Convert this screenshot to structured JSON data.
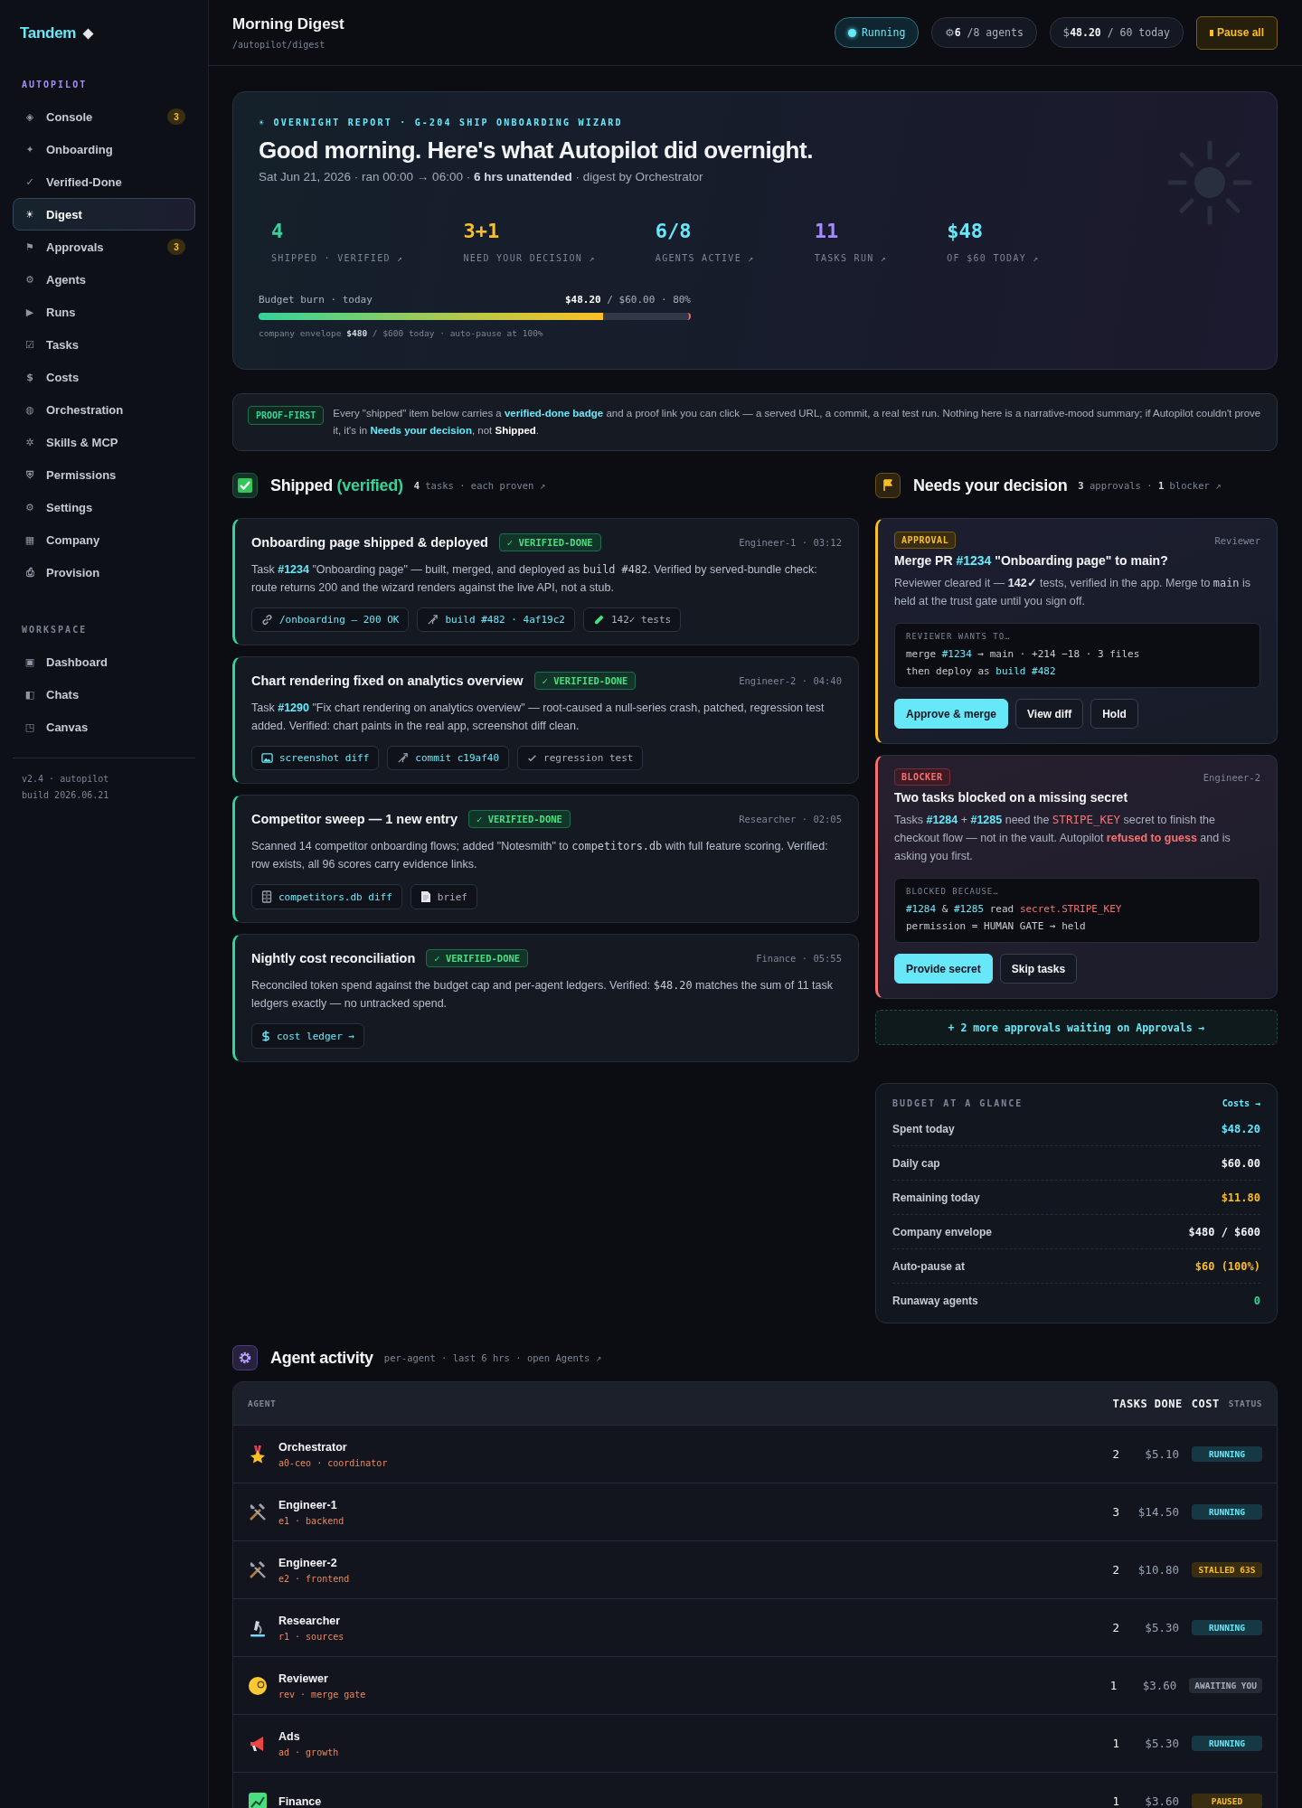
{
  "sidebar": {
    "logo": "Tandem",
    "sections": [
      {
        "title": "AUTOPILOT",
        "color": "#a78bfa",
        "items": [
          {
            "glyph": "◈",
            "label": "Console",
            "badge": "3",
            "selected": false
          },
          {
            "glyph": "✦",
            "label": "Onboarding",
            "selected": false
          },
          {
            "glyph": "✓",
            "label": "Verified-Done",
            "selected": false
          },
          {
            "glyph": "☀",
            "label": "Digest",
            "selected": true
          },
          {
            "glyph": "⚑",
            "label": "Approvals",
            "badge": "3",
            "selected": false
          },
          {
            "glyph": "⚙",
            "label": "Agents",
            "selected": false
          },
          {
            "glyph": "▶",
            "label": "Runs",
            "selected": false
          },
          {
            "glyph": "☑",
            "label": "Tasks",
            "selected": false
          },
          {
            "glyph": "$",
            "label": "Costs",
            "selected": false
          },
          {
            "glyph": "◍",
            "label": "Orchestration",
            "selected": false
          },
          {
            "glyph": "✲",
            "label": "Skills & MCP",
            "selected": false
          },
          {
            "glyph": "⛨",
            "label": "Permissions",
            "selected": false
          },
          {
            "glyph": "⚙",
            "label": "Settings",
            "selected": false
          },
          {
            "glyph": "▦",
            "label": "Company",
            "selected": false
          },
          {
            "glyph": "⎙",
            "label": "Provision",
            "selected": false
          }
        ]
      },
      {
        "title": "WORKSPACE",
        "color": "#7d8596",
        "items": [
          {
            "glyph": "▣",
            "label": "Dashboard",
            "selected": false
          },
          {
            "glyph": "◧",
            "label": "Chats",
            "selected": false
          },
          {
            "glyph": "◳",
            "label": "Canvas",
            "selected": false
          }
        ]
      }
    ],
    "footer": [
      "v2.4 · autopilot",
      "build 2026.06.21"
    ]
  },
  "header": {
    "title": "Morning Digest",
    "path": "/autopilot/digest",
    "status": "Running",
    "agents": {
      "glyph": "⚙",
      "value": "6",
      "rest": "/8 agents"
    },
    "budget": {
      "glyph": "$",
      "value": "48.20",
      "rest": "/ 60 today"
    },
    "pause_button": "Pause all"
  },
  "hero": {
    "kicker": "☀ OVERNIGHT REPORT · G-204 SHIP ONBOARDING WIZARD",
    "title": "Good morning. Here's what Autopilot did overnight.",
    "subtitle": "Sat Jun 21, 2026 · ran 00:00 → 06:00 · **6 hrs unattended** · digest by Orchestrator",
    "stats": [
      {
        "value": "4",
        "label": "SHIPPED · VERIFIED ↗",
        "color": "#34d399"
      },
      {
        "value": "3+1",
        "label": "NEED YOUR DECISION ↗",
        "color": "#fbbf24"
      },
      {
        "value": "6/8",
        "label": "AGENTS ACTIVE ↗",
        "color": "#67e8f9"
      },
      {
        "value": "11",
        "label": "TASKS RUN ↗",
        "color": "#a78bfa"
      },
      {
        "value": "$48",
        "label": "OF $60 TODAY ↗",
        "color": "#67e8f9"
      }
    ],
    "budget": {
      "label": "Budget burn · today",
      "reading": "**$48.20** / $60.00 · 80%",
      "level": 0.8,
      "note": "company envelope **$480** / $600 today · auto-pause at 100%"
    }
  },
  "notice": {
    "tag": "PROOF-FIRST",
    "text": [
      {
        "kind": "text",
        "text": "Every \"shipped\" item below carries a "
      },
      {
        "kind": "link",
        "text": "verified-done badge"
      },
      {
        "kind": "text",
        "text": " and a proof link you can click — a served URL, a commit, a real test run. Nothing here is a narrative-mood summary; if Autopilot couldn't prove it, it's in "
      },
      {
        "kind": "link",
        "text": "Needs your decision"
      },
      {
        "kind": "text",
        "text": ", not **Shipped**."
      }
    ]
  },
  "shipped": {
    "title": "Shipped",
    "accent": "(verified)",
    "meta": "**4** tasks · each proven ↗",
    "tasks": [
      {
        "title": "Onboarding page shipped & deployed",
        "badge": "✓ VERIFIED-DONE",
        "meta": "Engineer-1 · 03:12",
        "text": [
          {
            "kind": "text",
            "text": "Task "
          },
          {
            "kind": "ref",
            "text": "#1234"
          },
          {
            "kind": "text",
            "text": " \"Onboarding page\" — built, merged, and deployed as "
          },
          {
            "kind": "code",
            "text": "build #482"
          },
          {
            "kind": "text",
            "text": ". Verified by served-bundle check: route returns 200 and the wizard renders against the live API, not a stub."
          }
        ],
        "proofs": [
          {
            "kind": "link",
            "text": "/onboarding — 200 OK",
            "linked": true
          },
          {
            "kind": "branch",
            "text": "build #482 · 4af19c2",
            "linked": true
          },
          {
            "kind": "flask",
            "text": "142✓ tests",
            "linked": false
          }
        ]
      },
      {
        "title": "Chart rendering fixed on analytics overview",
        "badge": "✓ VERIFIED-DONE",
        "meta": "Engineer-2 · 04:40",
        "text": [
          {
            "kind": "text",
            "text": "Task "
          },
          {
            "kind": "ref",
            "text": "#1290"
          },
          {
            "kind": "text",
            "text": " \"Fix chart rendering on analytics overview\" — root-caused a null-series crash, patched, regression test added. Verified: chart paints in the real app, screenshot diff clean."
          }
        ],
        "proofs": [
          {
            "kind": "image",
            "text": "screenshot diff",
            "linked": true
          },
          {
            "kind": "branch",
            "text": "commit c19af40",
            "linked": true
          },
          {
            "kind": "check",
            "text": "regression test",
            "linked": false
          }
        ]
      },
      {
        "title": "Competitor sweep — 1 new entry",
        "badge": "✓ VERIFIED-DONE",
        "meta": "Researcher · 02:05",
        "text": [
          {
            "kind": "text",
            "text": "Scanned 14 competitor onboarding flows; added \"Notesmith\" to "
          },
          {
            "kind": "code",
            "text": "competitors.db"
          },
          {
            "kind": "text",
            "text": " with full feature scoring. Verified: row exists, all 96 scores carry evidence links."
          }
        ],
        "proofs": [
          {
            "kind": "db",
            "text": "competitors.db diff",
            "linked": true
          },
          {
            "kind": "doc",
            "text": "brief",
            "linked": false
          }
        ]
      },
      {
        "title": "Nightly cost reconciliation",
        "badge": "✓ VERIFIED-DONE",
        "meta": "Finance · 05:55",
        "text": [
          {
            "kind": "text",
            "text": "Reconciled token spend against the budget cap and per-agent ledgers. Verified: "
          },
          {
            "kind": "code",
            "text": "$48.20"
          },
          {
            "kind": "text",
            "text": " matches the sum of 11 task ledgers exactly — no untracked spend."
          }
        ],
        "proofs": [
          {
            "kind": "dollar",
            "text": "cost ledger →",
            "linked": true
          }
        ]
      }
    ]
  },
  "decisions": {
    "title": "Needs your decision",
    "meta": "**3** approvals · **1** blocker ↗",
    "cards": [
      {
        "kind": "approval",
        "tag": "APPROVAL",
        "who": "Reviewer",
        "title": [
          {
            "kind": "text",
            "text": "Merge PR "
          },
          {
            "kind": "ref",
            "text": "#1234"
          },
          {
            "kind": "text",
            "text": " \"Onboarding page\" to main?"
          }
        ],
        "text": [
          {
            "kind": "text",
            "text": "Reviewer cleared it — **142✓** tests, verified in the app. Merge to "
          },
          {
            "kind": "code",
            "text": "main"
          },
          {
            "kind": "text",
            "text": " is held at the trust gate until you sign off."
          }
        ],
        "box": {
          "label": "REVIEWER WANTS TO…",
          "lines": [
            [
              {
                "kind": "text",
                "text": "merge "
              },
              {
                "kind": "ref",
                "text": "#1234"
              },
              {
                "kind": "text",
                "text": " → main · +214 −18 · 3 files"
              }
            ],
            [
              {
                "kind": "text",
                "text": "then deploy as "
              },
              {
                "kind": "ref",
                "text": "build #482"
              }
            ]
          ]
        },
        "buttons": [
          {
            "label": "Approve & merge",
            "primary": true
          },
          {
            "label": "View diff",
            "primary": false
          },
          {
            "label": "Hold",
            "primary": false
          }
        ]
      },
      {
        "kind": "blocker",
        "tag": "BLOCKER",
        "who": "Engineer-2",
        "title": [
          {
            "kind": "text",
            "text": "Two tasks blocked on a missing secret"
          }
        ],
        "text": [
          {
            "kind": "text",
            "text": "Tasks "
          },
          {
            "kind": "ref",
            "text": "#1284"
          },
          {
            "kind": "text",
            "text": " + "
          },
          {
            "kind": "ref",
            "text": "#1285"
          },
          {
            "kind": "text",
            "text": " need the "
          },
          {
            "kind": "secret",
            "text": "STRIPE_KEY"
          },
          {
            "kind": "text",
            "text": " secret to finish the checkout flow — not in the vault. Autopilot "
          },
          {
            "kind": "alert",
            "text": "refused to guess"
          },
          {
            "kind": "text",
            "text": " and is asking you first."
          }
        ],
        "box": {
          "label": "BLOCKED BECAUSE…",
          "lines": [
            [
              {
                "kind": "ref",
                "text": "#1284"
              },
              {
                "kind": "text",
                "text": " & "
              },
              {
                "kind": "ref",
                "text": "#1285"
              },
              {
                "kind": "text",
                "text": " read "
              },
              {
                "kind": "secret",
                "text": "secret.STRIPE_KEY"
              }
            ],
            [
              {
                "kind": "text",
                "text": "permission = HUMAN GATE → held"
              }
            ]
          ]
        },
        "buttons": [
          {
            "label": "Provide secret",
            "primary": true
          },
          {
            "label": "Skip tasks",
            "primary": false
          }
        ]
      }
    ],
    "more_link": "+ 2 more approvals waiting on Approvals →"
  },
  "budget": {
    "title": "BUDGET AT A GLANCE",
    "link": "Costs →",
    "rows": [
      {
        "label": "Spent today",
        "value": "$48.20",
        "color": "#67e8f9"
      },
      {
        "label": "Daily cap",
        "value": "$60.00",
        "color": "#f3f4f6"
      },
      {
        "label": "Remaining today",
        "value": "$11.80",
        "color": "#fbbf24"
      },
      {
        "label": "Company envelope",
        "value": "$480 / $600",
        "color": "#f3f4f6"
      },
      {
        "label": "Auto-pause at",
        "value": "$60 (100%)",
        "color": "#fbbf24"
      },
      {
        "label": "Runaway agents",
        "value": "0",
        "color": "#34d399"
      }
    ]
  },
  "agents": {
    "title": "Agent activity",
    "meta": "per-agent · last 6 hrs · open Agents ↗",
    "columns": [
      "AGENT",
      "TASKS DONE",
      "COST",
      "STATUS"
    ],
    "rows": [
      {
        "name": "Orchestrator",
        "sub": "a0-ceo · coordinator",
        "tasks": "2",
        "cost": "$5.10",
        "status": {
          "label": "RUNNING",
          "kind": "running"
        }
      },
      {
        "name": "Engineer-1",
        "sub": "e1 · backend",
        "tasks": "3",
        "cost": "$14.50",
        "status": {
          "label": "RUNNING",
          "kind": "running"
        }
      },
      {
        "name": "Engineer-2",
        "sub": "e2 · frontend",
        "tasks": "2",
        "cost": "$10.80",
        "status": {
          "label": "STALLED 63S",
          "kind": "stalled"
        }
      },
      {
        "name": "Researcher",
        "sub": "r1 · sources",
        "tasks": "2",
        "cost": "$5.30",
        "status": {
          "label": "RUNNING",
          "kind": "running"
        }
      },
      {
        "name": "Reviewer",
        "sub": "rev · merge gate",
        "tasks": "1",
        "cost": "$3.60",
        "status": {
          "label": "AWAITING YOU",
          "kind": "awaiting"
        }
      },
      {
        "name": "Ads",
        "sub": "ad · growth",
        "tasks": "1",
        "cost": "$5.30",
        "status": {
          "label": "RUNNING",
          "kind": "running"
        }
      },
      {
        "name": "Finance",
        "tasks": "1",
        "cost": "$3.60",
        "status": {
          "label": "PAUSED",
          "kind": "paused"
        }
      }
    ]
  }
}
